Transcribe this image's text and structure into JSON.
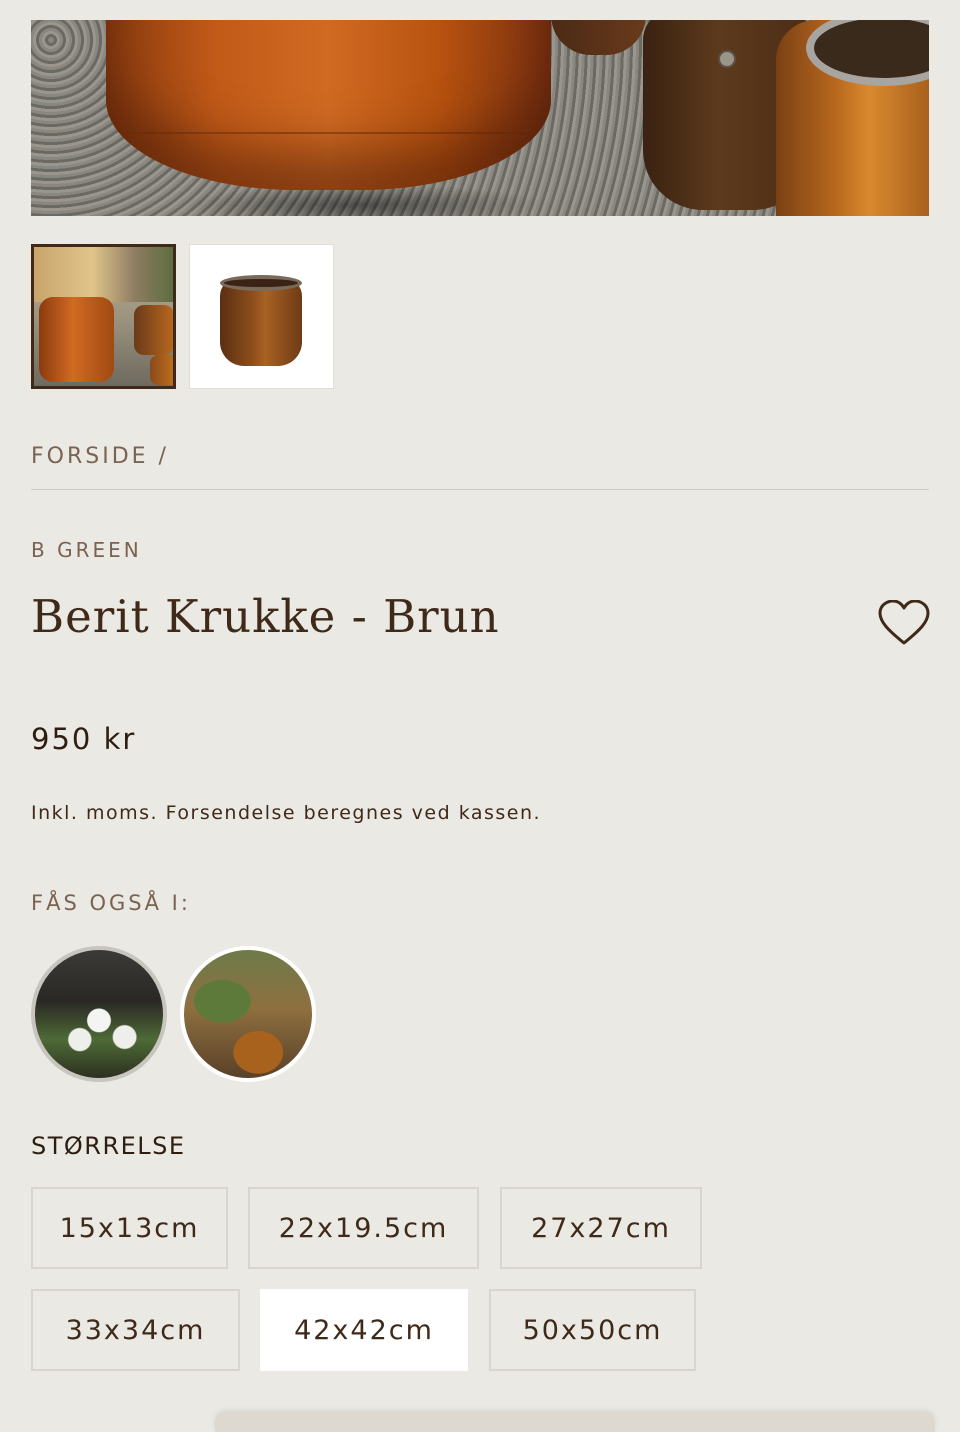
{
  "gallery": {
    "main_image": "product-photo",
    "thumbnails": [
      "thumbnail-lifestyle",
      "thumbnail-product"
    ],
    "selected_thumbnail": 0
  },
  "breadcrumb": {
    "home": "FORSIDE /"
  },
  "product": {
    "vendor": "B GREEN",
    "title": "Berit Krukke - Brun",
    "price": "950 kr",
    "tax_note": "Inkl. moms. Forsendelse beregnes ved kassen.",
    "wishlist_icon": "heart-icon"
  },
  "variants": {
    "label": "FÅS OGSÅ I:",
    "swatches": [
      "variant-dark",
      "variant-brown"
    ]
  },
  "sizes": {
    "label": "STØRRELSE",
    "options": [
      "15x13cm",
      "22x19.5cm",
      "27x27cm",
      "33x34cm",
      "42x42cm",
      "50x50cm"
    ],
    "selected": "42x42cm"
  },
  "colors": {
    "background": "#ebe9e4",
    "text": "#3f2a1a",
    "muted": "#7a6350",
    "selected_bg": "#ffffff"
  }
}
